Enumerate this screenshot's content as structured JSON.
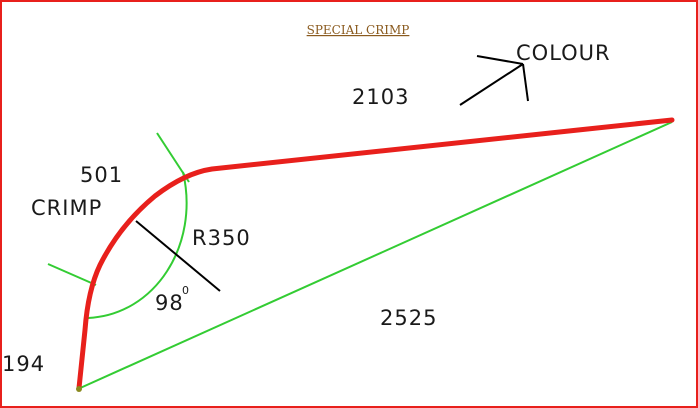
{
  "title": "SPECIAL CRIMP",
  "labels": {
    "colour": "COLOUR",
    "length_top": "2103",
    "length_bend": "501",
    "crimp": "CRIMP",
    "radius": "R350",
    "angle": "98",
    "angle_unit": "0",
    "length_bottom": "2525",
    "length_left": "194"
  },
  "colors": {
    "border": "#e8201c",
    "profile": "#e8201c",
    "dimension": "#33cc33",
    "leader": "#000000",
    "title": "#8a5a1e"
  }
}
